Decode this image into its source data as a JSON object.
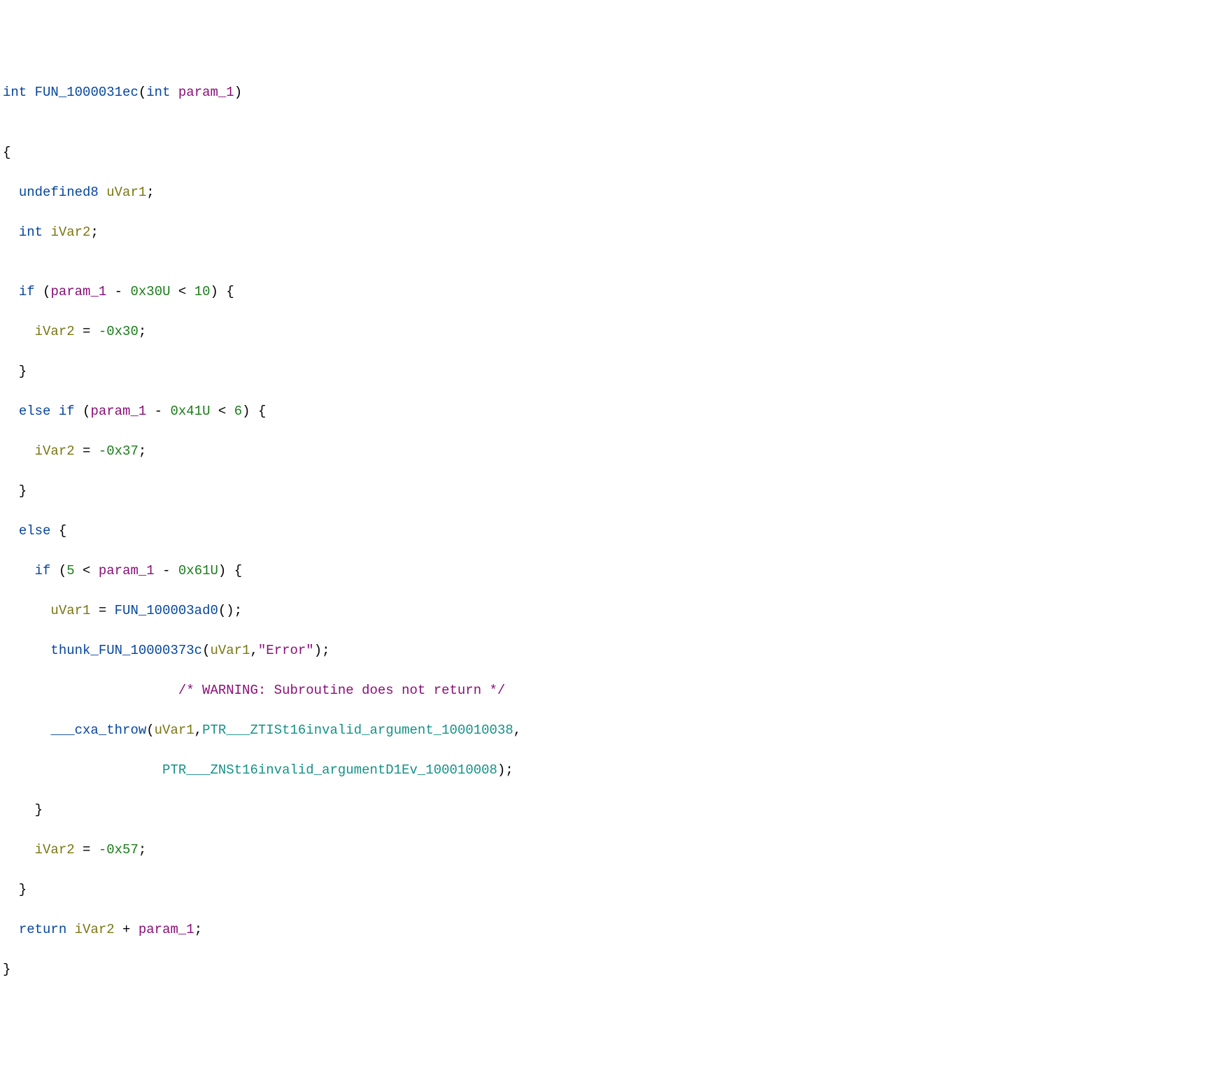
{
  "colors": {
    "type": "#0646a0",
    "func": "#0646a0",
    "param": "#8a0f78",
    "var": "#7a7612",
    "kw": "#0646a0",
    "num": "#1a7d1a",
    "str": "#8a0f78",
    "ptr": "#169187",
    "comment": "#8a0f78"
  },
  "code": {
    "l1": {
      "type": "int",
      "space": " ",
      "func": "FUN_1000031ec",
      "open": "(",
      "ptype": "int",
      "pspace": " ",
      "param": "param_1",
      "close": ")"
    },
    "l2": "",
    "l3": "{",
    "l4": {
      "indent": "  ",
      "type": "undefined8",
      "space": " ",
      "var": "uVar1",
      "semi": ";"
    },
    "l5": {
      "indent": "  ",
      "type": "int",
      "space": " ",
      "var": "iVar2",
      "semi": ";"
    },
    "l6": "",
    "l7": {
      "indent": "  ",
      "kw": "if",
      "space": " (",
      "param": "param_1",
      "mid": " - ",
      "hex": "0x30U",
      "cmp": " < ",
      "n": "10",
      "close": ") {"
    },
    "l8": {
      "indent": "    ",
      "var": "iVar2",
      "eq": " = ",
      "neg": "-",
      "hex": "0x30",
      "semi": ";"
    },
    "l9": "  }",
    "l10": {
      "indent": "  ",
      "kw1": "else",
      "sp1": " ",
      "kw2": "if",
      "space": " (",
      "param": "param_1",
      "mid": " - ",
      "hex": "0x41U",
      "cmp": " < ",
      "n": "6",
      "close": ") {"
    },
    "l11": {
      "indent": "    ",
      "var": "iVar2",
      "eq": " = ",
      "neg": "-",
      "hex": "0x37",
      "semi": ";"
    },
    "l12": "  }",
    "l13": {
      "indent": "  ",
      "kw": "else",
      "close": " {"
    },
    "l14": {
      "indent": "    ",
      "kw": "if",
      "space": " (",
      "n": "5",
      "cmp": " < ",
      "param": "param_1",
      "mid": " - ",
      "hex": "0x61U",
      "close": ") {"
    },
    "l15": {
      "indent": "      ",
      "var": "uVar1",
      "eq": " = ",
      "call": "FUN_100003ad0",
      "suffix": "();"
    },
    "l16": {
      "indent": "      ",
      "call": "thunk_FUN_10000373c",
      "open": "(",
      "var": "uVar1",
      "comma": ",",
      "str": "\"Error\"",
      "close": ");"
    },
    "l17": {
      "indent": "                      ",
      "comment": "/* WARNING: Subroutine does not return */"
    },
    "l18": {
      "indent": "      ",
      "call": "___cxa_throw",
      "open": "(",
      "var": "uVar1",
      "comma": ",",
      "ptr": "PTR___ZTISt16invalid_argument_100010038",
      "comma2": ","
    },
    "l19": {
      "indent": "                    ",
      "ptr": "PTR___ZNSt16invalid_argumentD1Ev_100010008",
      "close": ");"
    },
    "l20": "    }",
    "l21": {
      "indent": "    ",
      "var": "iVar2",
      "eq": " = ",
      "neg": "-",
      "hex": "0x57",
      "semi": ";"
    },
    "l22": "  }",
    "l23": {
      "indent": "  ",
      "kw": "return",
      "space": " ",
      "var": "iVar2",
      "mid": " + ",
      "param": "param_1",
      "semi": ";"
    },
    "l24": "}"
  }
}
